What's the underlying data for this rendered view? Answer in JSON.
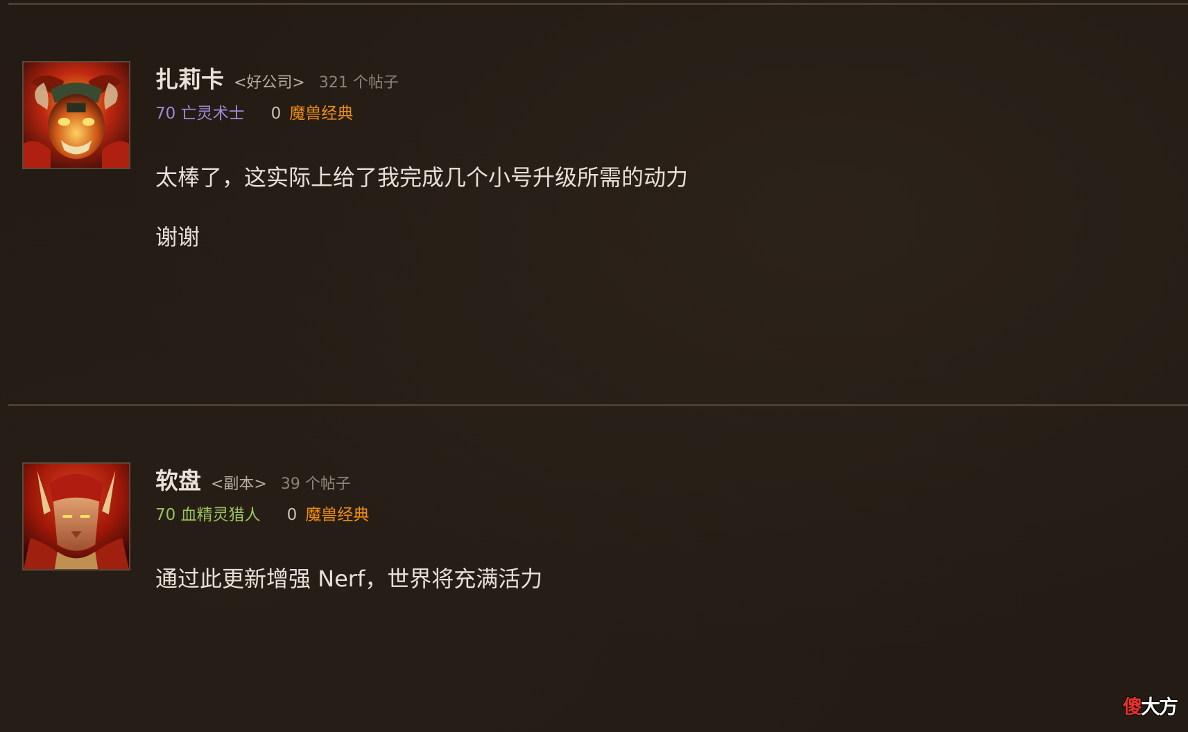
{
  "posts": [
    {
      "author": "扎莉卡",
      "guild": "<好公司>",
      "post_count": "321 个帖子",
      "character": "70 亡灵术士",
      "reputation": "0",
      "game": "魔兽经典",
      "body": [
        "太棒了，这实际上给了我完成几个小号升级所需的动力",
        "谢谢"
      ],
      "avatar_icon": "demon-avatar-icon",
      "class_color": "#9f8bd9"
    },
    {
      "author": "软盘",
      "guild": "<副本>",
      "post_count": "39 个帖子",
      "character": "70 血精灵猎人",
      "reputation": "0",
      "game": "魔兽经典",
      "body": [
        "通过此更新增强 Nerf，世界将充满活力"
      ],
      "avatar_icon": "blood-elf-avatar-icon",
      "class_color": "#9bc35a"
    }
  ],
  "watermark": {
    "part1": "傻",
    "part2": "大方"
  },
  "colors": {
    "background": "#231b14",
    "game_link": "#f08e12",
    "divider": "#4a4036"
  }
}
